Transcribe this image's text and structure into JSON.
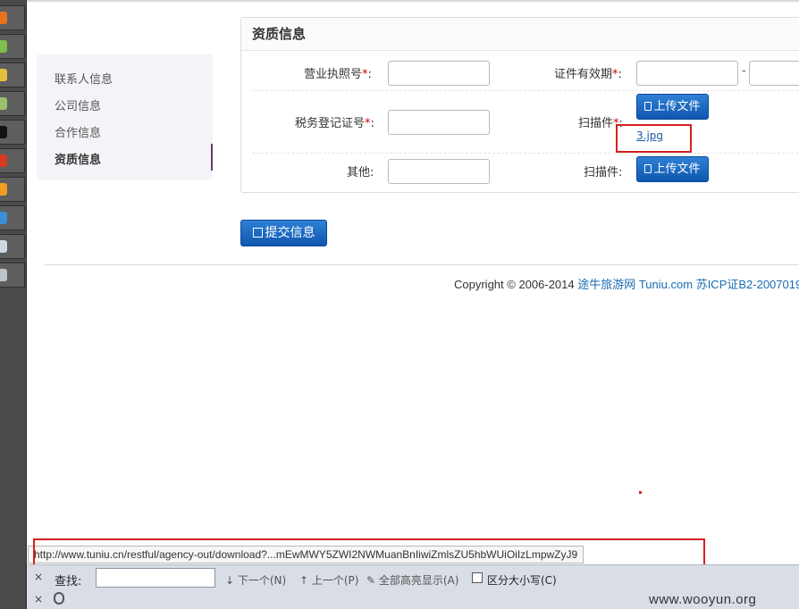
{
  "form": {
    "side_menu": {
      "items": [
        "联系人信息",
        "公司信息",
        "合作信息",
        "资质信息"
      ],
      "active_index": 3
    },
    "panel_title": "资质信息",
    "rows": {
      "license_label": "营业执照号",
      "validity_label": "证件有效期",
      "validity_separator": "-",
      "tax_label": "税务登记证号",
      "scan_label": "扫描件",
      "other_label": "其他",
      "required_mark": "*",
      "colon": ":",
      "upload_button": "上传文件",
      "uploaded_file": "3.jpg"
    },
    "submit_button": "提交信息"
  },
  "footer": {
    "copyright_prefix": "Copyright © 2006-2014",
    "site_name": "途牛旅游网 Tuniu.com",
    "icp": "苏ICP证B2-2007019"
  },
  "status_bar": {
    "url": "http://www.tuniu.cn/restful/agency-out/download?...mEwMWY5ZWI2NWMuanBnIiwiZmlsZU5hbWUiOiIzLmpwZyJ9"
  },
  "find_bar": {
    "close": "×",
    "label": "查找:",
    "next": "下一个(N)",
    "prev": "上一个(P)",
    "highlight_all": "全部高亮显示(A)",
    "match_case": "区分大小写(C)"
  },
  "watermark": "www.wooyun.org",
  "colors": {
    "accent_blue": "#1a5fb8",
    "annotation_red": "#d62020",
    "required_red": "#d40000",
    "taskbar": "#4a4a4a"
  }
}
